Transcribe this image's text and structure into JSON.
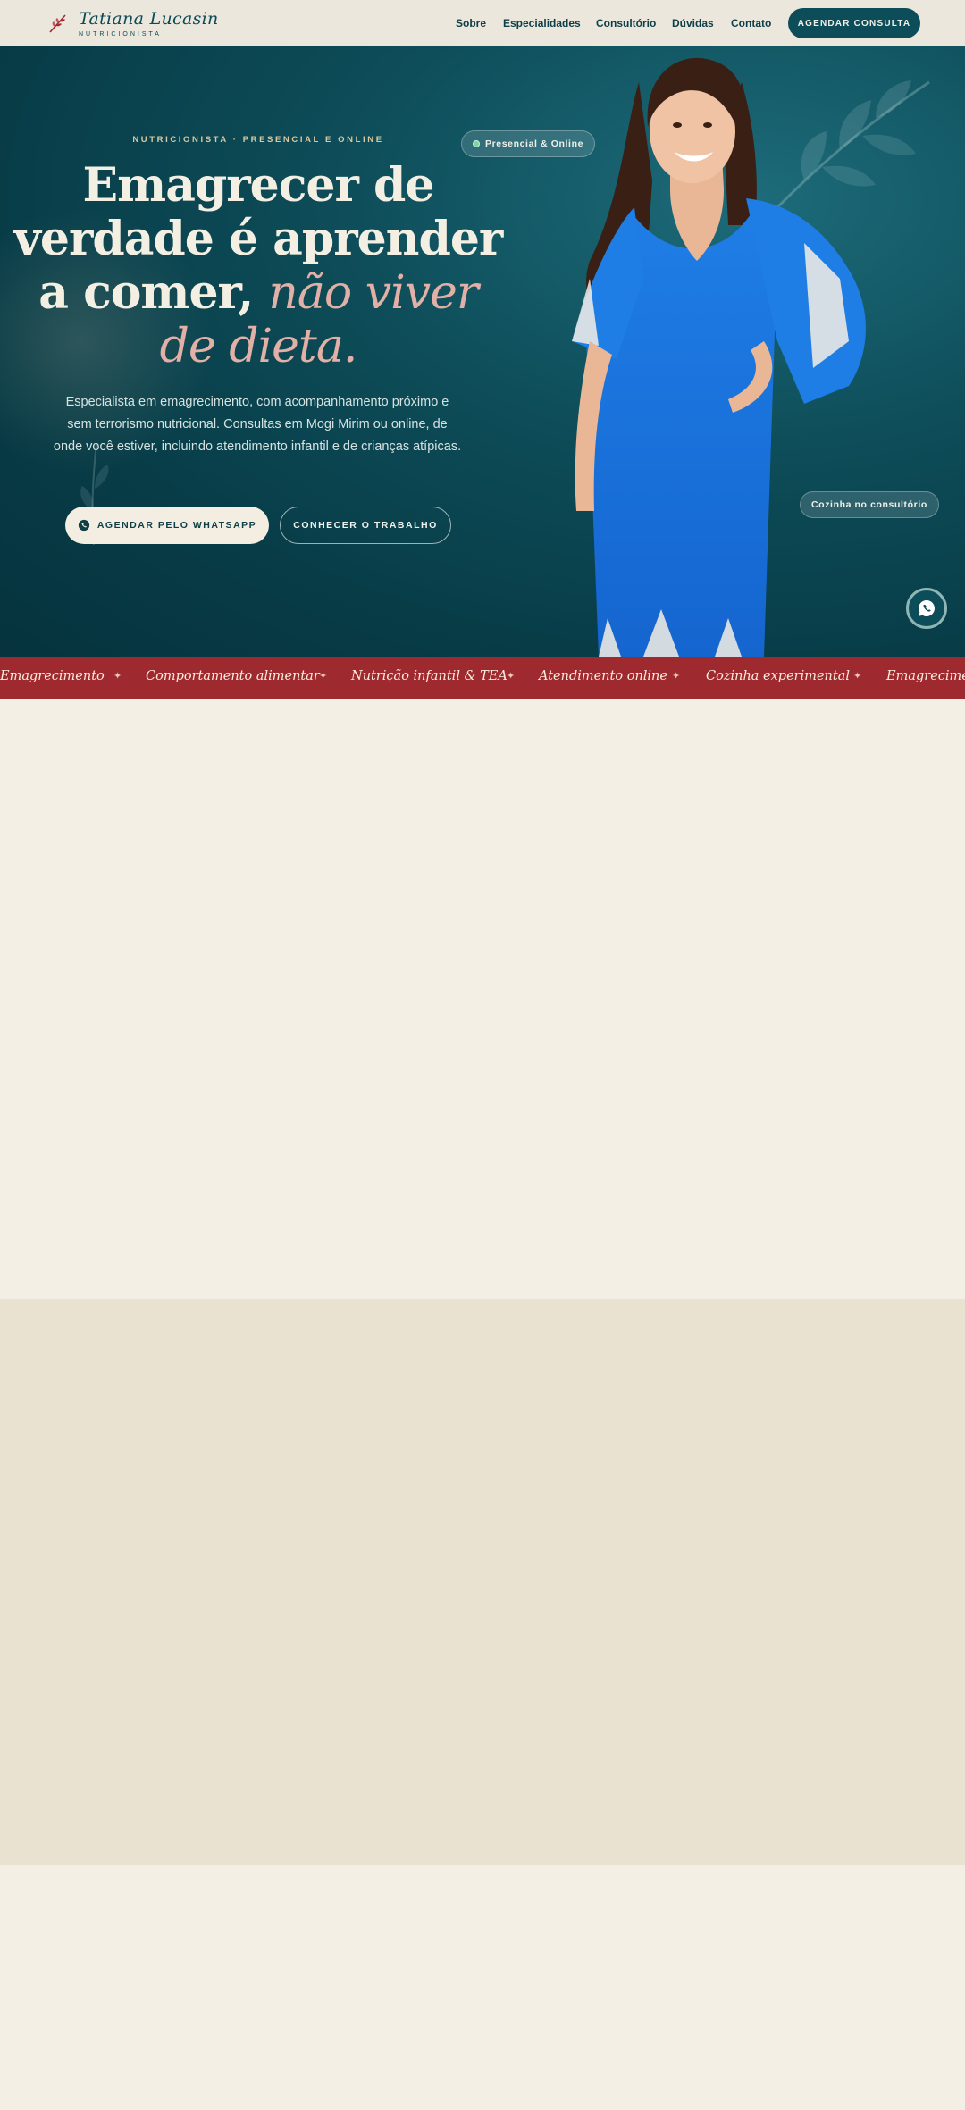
{
  "brand": {
    "name": "Tatiana Lucasin",
    "subtitle": "NUTRICIONISTA"
  },
  "nav": {
    "links": [
      "Sobre",
      "Especialidades",
      "Consultório",
      "Dúvidas",
      "Contato"
    ],
    "cta": "AGENDAR CONSULTA"
  },
  "hero": {
    "eyebrow": "NUTRICIONISTA · PRESENCIAL E ONLINE",
    "headline_line1": "Emagrecer de",
    "headline_line2": "verdade é aprender",
    "headline_line3_plain": "a comer, ",
    "headline_line3_accent": "não viver",
    "headline_line4_accent": "de dieta.",
    "description": "Especialista em emagrecimento, com acompanhamento próximo e sem terrorismo nutricional. Consultas em Mogi Mirim ou online, de onde você estiver, incluindo atendimento infantil e de crianças atípicas.",
    "primary_button": "AGENDAR PELO WHATSAPP",
    "secondary_button": "CONHECER O TRABALHO",
    "badge_top": "Presencial & Online",
    "badge_bottom": "Cozinha no consultório"
  },
  "marquee": {
    "items": [
      "Emagrecimento",
      "Comportamento alimentar",
      "Nutrição infantil & TEA",
      "Atendimento online",
      "Cozinha experimental",
      "Emagrecimento"
    ],
    "separator": "✦"
  },
  "colors": {
    "nav_bg": "#ebe7dd",
    "teal_dark": "#0d4d5a",
    "accent_pink": "#e2b0a6",
    "marquee_red": "#9e2a2f",
    "cream": "#f3efe4",
    "sand": "#e9e2d1"
  },
  "icons": {
    "brand": "sprig-logo-icon",
    "whatsapp": "whatsapp-icon",
    "badge_dot": "status-dot-icon"
  }
}
